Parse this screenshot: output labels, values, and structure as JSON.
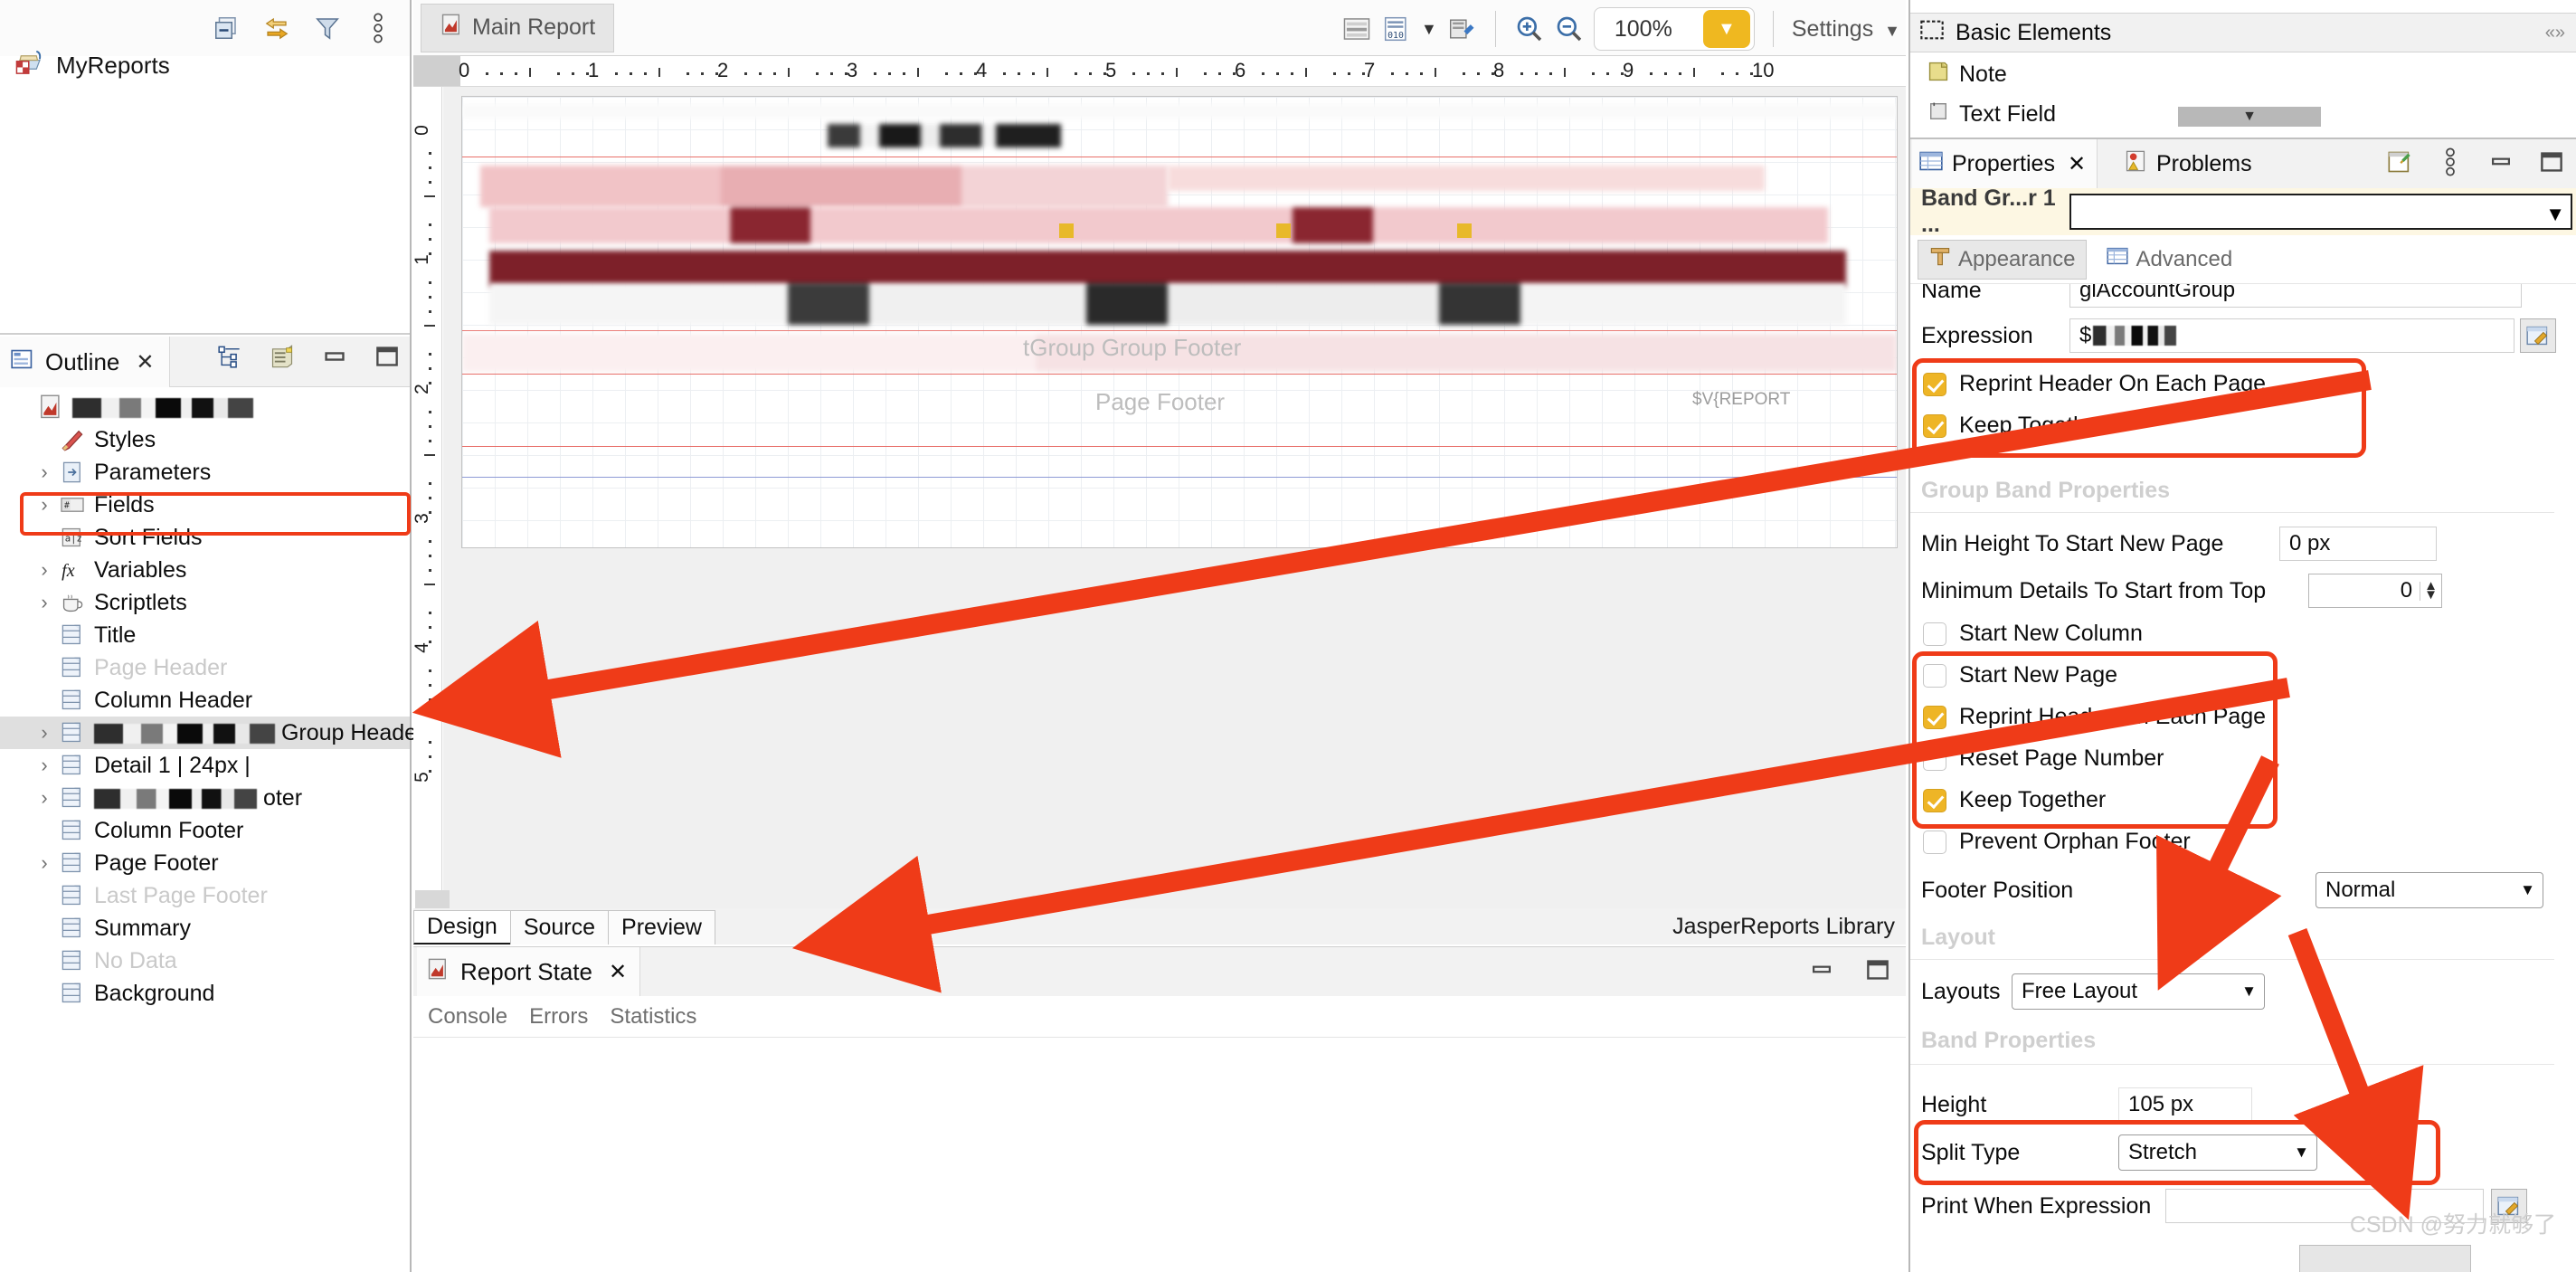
{
  "app": {
    "projects_panel": {
      "root_item": "MyReports",
      "toolbar_icons": [
        "collapse-all-icon",
        "link-with-editor-icon",
        "filter-icon",
        "view-menu-icon"
      ]
    },
    "outline": {
      "tab_label": "Outline",
      "close_label": "✕",
      "tool_icons": [
        "tree-layout-icon",
        "sort-icon",
        "minimize-icon",
        "maximize-icon"
      ],
      "items": [
        {
          "label": "",
          "redacted": true,
          "icon": "report-icon",
          "twisty": "",
          "indent": 0,
          "muted": false
        },
        {
          "label": "Styles",
          "redacted": false,
          "icon": "styles-icon",
          "twisty": "",
          "indent": 1,
          "muted": false
        },
        {
          "label": "Parameters",
          "redacted": false,
          "icon": "parameters-icon",
          "twisty": "›",
          "indent": 1,
          "muted": false
        },
        {
          "label": "Fields",
          "redacted": false,
          "icon": "fields-icon",
          "twisty": "›",
          "indent": 1,
          "muted": false
        },
        {
          "label": "Sort Fields",
          "redacted": false,
          "icon": "sort-fields-icon",
          "twisty": "",
          "indent": 1,
          "muted": false
        },
        {
          "label": "Variables",
          "redacted": false,
          "icon": "variables-icon",
          "twisty": "›",
          "indent": 1,
          "muted": false
        },
        {
          "label": "Scriptlets",
          "redacted": false,
          "icon": "scriptlets-icon",
          "twisty": "›",
          "indent": 1,
          "muted": false
        },
        {
          "label": "Title",
          "redacted": false,
          "icon": "band-icon",
          "twisty": "",
          "indent": 1,
          "muted": false
        },
        {
          "label": "Page Header",
          "redacted": false,
          "icon": "band-icon",
          "twisty": "",
          "indent": 1,
          "muted": true
        },
        {
          "label": "Column Header",
          "redacted": false,
          "icon": "band-icon",
          "twisty": "",
          "indent": 1,
          "muted": false
        },
        {
          "label": "Group Header",
          "redacted": true,
          "icon": "band-icon",
          "twisty": "›",
          "indent": 1,
          "muted": false,
          "selected": true
        },
        {
          "label": "Detail 1 | 24px |",
          "redacted": false,
          "icon": "band-icon",
          "twisty": "›",
          "indent": 1,
          "muted": false
        },
        {
          "label": "oter",
          "redacted": true,
          "icon": "band-icon",
          "twisty": "›",
          "indent": 1,
          "muted": false
        },
        {
          "label": "Column Footer",
          "redacted": false,
          "icon": "band-icon",
          "twisty": "",
          "indent": 1,
          "muted": false
        },
        {
          "label": "Page Footer",
          "redacted": false,
          "icon": "band-icon",
          "twisty": "›",
          "indent": 1,
          "muted": false
        },
        {
          "label": "Last Page Footer",
          "redacted": false,
          "icon": "band-icon",
          "twisty": "",
          "indent": 1,
          "muted": true
        },
        {
          "label": "Summary",
          "redacted": false,
          "icon": "band-icon",
          "twisty": "",
          "indent": 1,
          "muted": false
        },
        {
          "label": "No Data",
          "redacted": false,
          "icon": "band-icon",
          "twisty": "",
          "indent": 1,
          "muted": true
        },
        {
          "label": "Background",
          "redacted": false,
          "icon": "band-icon",
          "twisty": "",
          "indent": 1,
          "muted": false
        }
      ]
    },
    "designer": {
      "tab_label": "Main Report",
      "toolbar": {
        "zoom_value": "100%",
        "settings_label": "Settings",
        "icons": [
          "dataset-icon",
          "data-preview-icon",
          "compile-icon",
          "zoom-in-icon",
          "zoom-out-icon"
        ]
      },
      "ruler_h_marks": [
        "0",
        "1",
        "2",
        "3",
        "4",
        "5",
        "6",
        "7",
        "8",
        "9",
        "10"
      ],
      "ruler_v_marks": [
        "0",
        "1",
        "2",
        "3",
        "4",
        "5"
      ],
      "band_labels": [
        "tGroup Group Footer",
        "Page Footer",
        "$V{REPORT"
      ],
      "view_tabs": [
        {
          "label": "Design",
          "active": true
        },
        {
          "label": "Source",
          "active": false
        },
        {
          "label": "Preview",
          "active": false
        }
      ],
      "footer_note": "JasperReports Library"
    },
    "report_state": {
      "tab_label": "Report State",
      "close_label": "✕",
      "subtabs": [
        "Console",
        "Errors",
        "Statistics"
      ],
      "win_icons": [
        "minimize-icon",
        "maximize-icon"
      ]
    },
    "palette": {
      "header": "Basic Elements",
      "header_icon": "dashed-rect-icon",
      "collapse_icon": "chevrons-icon",
      "items": [
        {
          "label": "Note",
          "icon": "note-icon"
        },
        {
          "label": "Text Field",
          "icon": "text-field-icon"
        }
      ]
    },
    "properties": {
      "tabs": [
        {
          "label": "Properties",
          "icon": "properties-icon",
          "active": true,
          "closable": true
        },
        {
          "label": "Problems",
          "icon": "problems-icon",
          "active": false,
          "closable": false
        }
      ],
      "tab_tool_icons": [
        "pin-icon",
        "view-menu-icon",
        "minimize-icon",
        "maximize-icon"
      ],
      "band_selector": {
        "label": "Band Gr...r 1 ...",
        "value": "",
        "caret": "▼"
      },
      "sub_tabs": [
        {
          "label": "Appearance",
          "icon": "appearance-icon",
          "active": true
        },
        {
          "label": "Advanced",
          "icon": "advanced-icon",
          "active": false
        }
      ],
      "fields": {
        "name_label": "Name",
        "name_value": "glAccountGroup",
        "expression_label": "Expression",
        "expression_value": "$"
      },
      "group_checkboxes_top": [
        {
          "label": "Reprint Header On Each Page",
          "checked": true
        },
        {
          "label": "Keep Together",
          "checked": true
        }
      ],
      "section_group_band": "Group Band Properties",
      "min_height_label": "Min Height To Start New Page",
      "min_height_value": "0 px",
      "min_details_label": "Minimum Details To Start from Top",
      "min_details_value": "0",
      "group_checkboxes": [
        {
          "label": "Start New Column",
          "checked": false
        },
        {
          "label": "Start New Page",
          "checked": false
        },
        {
          "label": "Reprint Header On Each Page",
          "checked": true
        },
        {
          "label": "Reset Page Number",
          "checked": false
        },
        {
          "label": "Keep Together",
          "checked": true
        },
        {
          "label": "Prevent Orphan Footer",
          "checked": false
        }
      ],
      "footer_position_label": "Footer Position",
      "footer_position_value": "Normal",
      "section_layout": "Layout",
      "layouts_label": "Layouts",
      "layouts_value": "Free Layout",
      "section_band": "Band Properties",
      "height_label": "Height",
      "height_value": "105 px",
      "split_type_label": "Split Type",
      "split_type_value": "Stretch",
      "print_when_label": "Print When Expression",
      "print_when_value": "",
      "watermark": "CSDN @努力就够了"
    },
    "colors": {
      "annotation_red": "#ef3b18",
      "accent_yellow": "#efb820",
      "checkbox_on": "#eeb526",
      "band_row_bg": "#fdf7e3"
    }
  }
}
